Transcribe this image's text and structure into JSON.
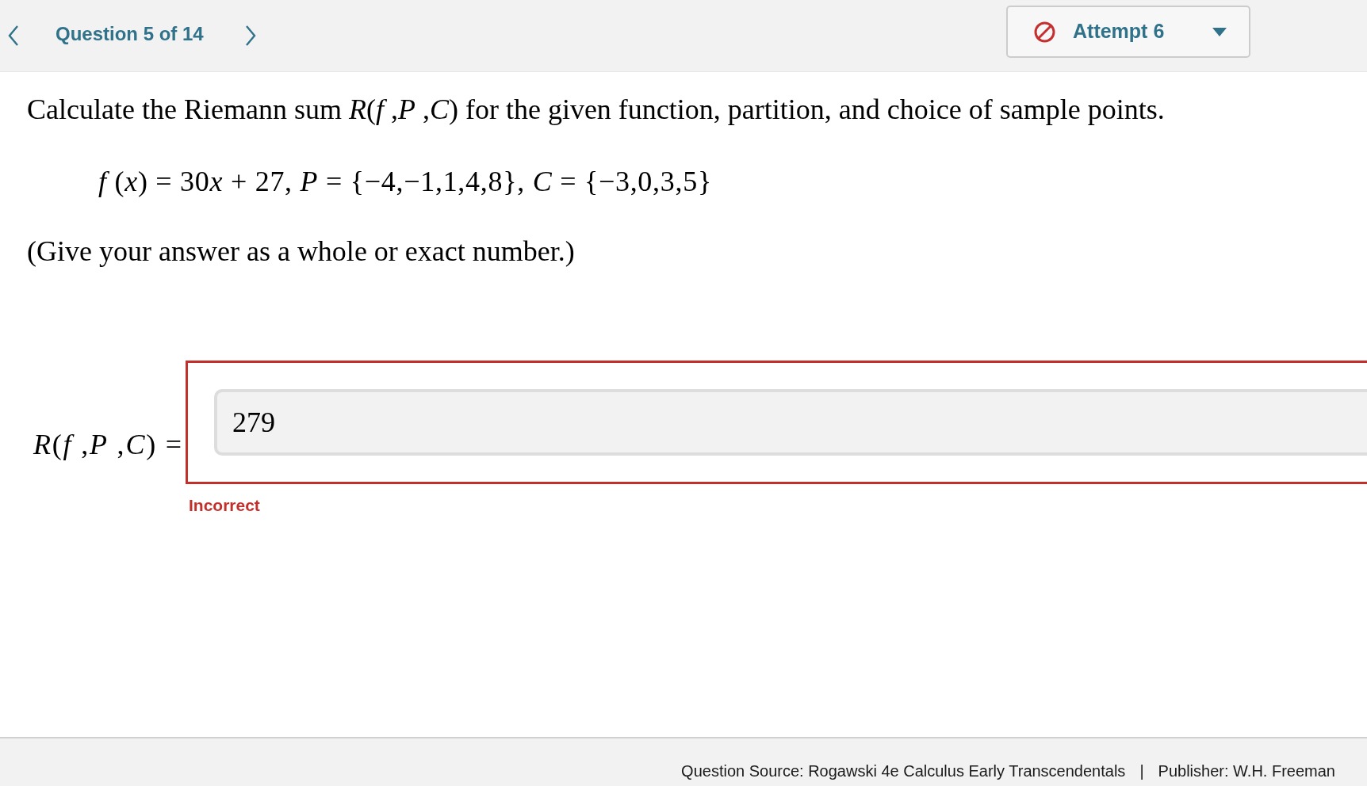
{
  "nav": {
    "question_label": "Question 5 of 14"
  },
  "attempt_menu": {
    "label": "Attempt 6"
  },
  "question": {
    "prompt": "Calculate the Riemann sum *R*(*f* ,*P* ,*C*) for the given function, partition, and choice of sample points.",
    "formula": [
      {
        "kind": "variable",
        "text": "f"
      },
      {
        "kind": "text",
        "text": " ("
      },
      {
        "kind": "variable",
        "text": "x"
      },
      {
        "kind": "text",
        "text": ") = 30"
      },
      {
        "kind": "variable",
        "text": "x"
      },
      {
        "kind": "text",
        "text": " + 27, "
      },
      {
        "kind": "variable",
        "text": "P"
      },
      {
        "kind": "text",
        "text": " = {−4,−1,1,4,8}, "
      },
      {
        "kind": "variable",
        "text": "C"
      },
      {
        "kind": "text",
        "text": " = {−3,0,3,5}"
      }
    ],
    "instruction": "(Give your answer as a whole or exact number.)"
  },
  "answer": {
    "label": "*R*(*f* ,*P* ,*C*) =",
    "value": "279",
    "correct": false,
    "feedback": "Incorrect"
  },
  "footer": {
    "source": "Question Source: Rogawski 4e Calculus Early Transcendentals",
    "separator": "|",
    "publisher": "Publisher: W.H. Freeman"
  }
}
